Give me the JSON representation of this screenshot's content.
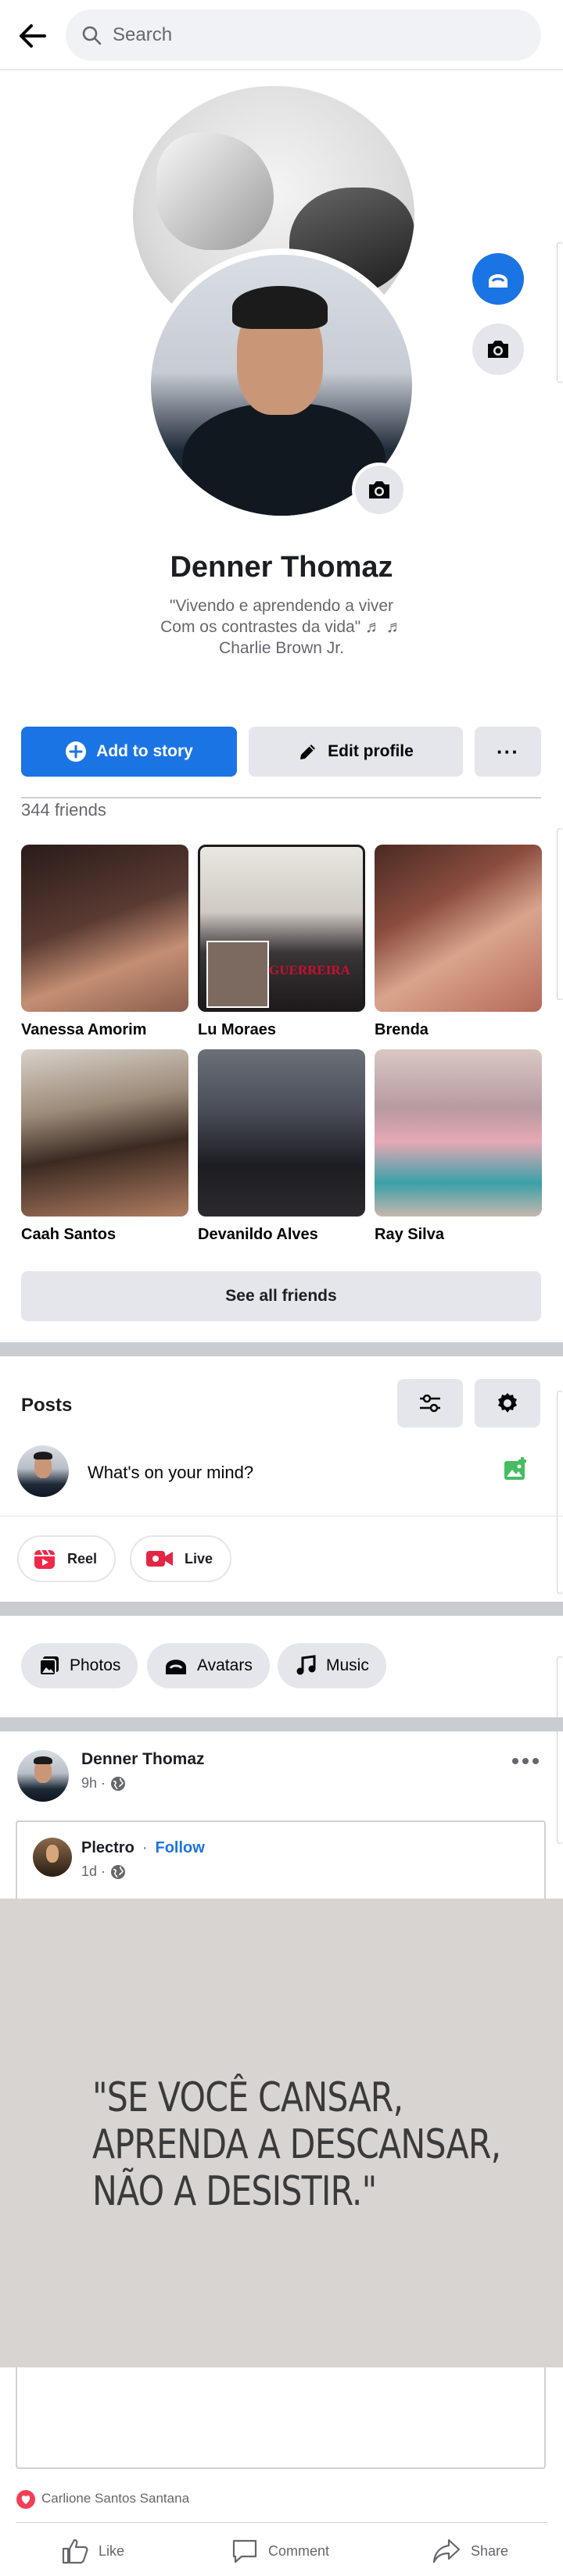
{
  "search": {
    "placeholder": "Search"
  },
  "profile": {
    "name": "Denner Thomaz",
    "bio_line1": "\"Vivendo e aprendendo a viver",
    "bio_line2": "Com os contrastes da vida\" ♬ ♬",
    "bio_line3": "Charlie Brown Jr."
  },
  "actions": {
    "add_to_story": "Add to story",
    "edit_profile": "Edit profile",
    "more": "···"
  },
  "friends": {
    "count_label": "344 friends",
    "items": [
      {
        "name": "Vanessa Amorim",
        "color": "#5a3b33"
      },
      {
        "name": "Lu Moraes",
        "color": "#3a3536"
      },
      {
        "name": "Brenda",
        "color": "#8a4d3f"
      },
      {
        "name": "Caah Santos",
        "color": "#6f5c4a"
      },
      {
        "name": "Devanildo Alves",
        "color": "#4b4f5a"
      },
      {
        "name": "Ray Silva",
        "color": "#7a6a70"
      }
    ],
    "overlay_text": "GUERREIRA",
    "see_all": "See all friends"
  },
  "posts": {
    "title": "Posts",
    "composer_placeholder": "What's on your mind?",
    "reel": "Reel",
    "live": "Live"
  },
  "chips": {
    "photos": "Photos",
    "avatars": "Avatars",
    "music": "Music"
  },
  "post": {
    "author": "Denner Thomaz",
    "time": "9h ·",
    "shared_author": "Plectro",
    "follow_sep": "·",
    "follow": "Follow",
    "shared_time": "1d ·",
    "quote_line1": "\"SE VOCÊ CANSAR,",
    "quote_line2": "APRENDA A DESCANSAR,",
    "quote_line3": "NÃO A DESISTIR.\"",
    "reactor": "Carlione Santos Santana",
    "like": "Like",
    "comment": "Comment",
    "share": "Share"
  },
  "colors": {
    "accent": "#1b74e4",
    "reel": "#f0284a",
    "live": "#e42645",
    "photo_green": "#45bd62",
    "love": "#f33e58"
  }
}
